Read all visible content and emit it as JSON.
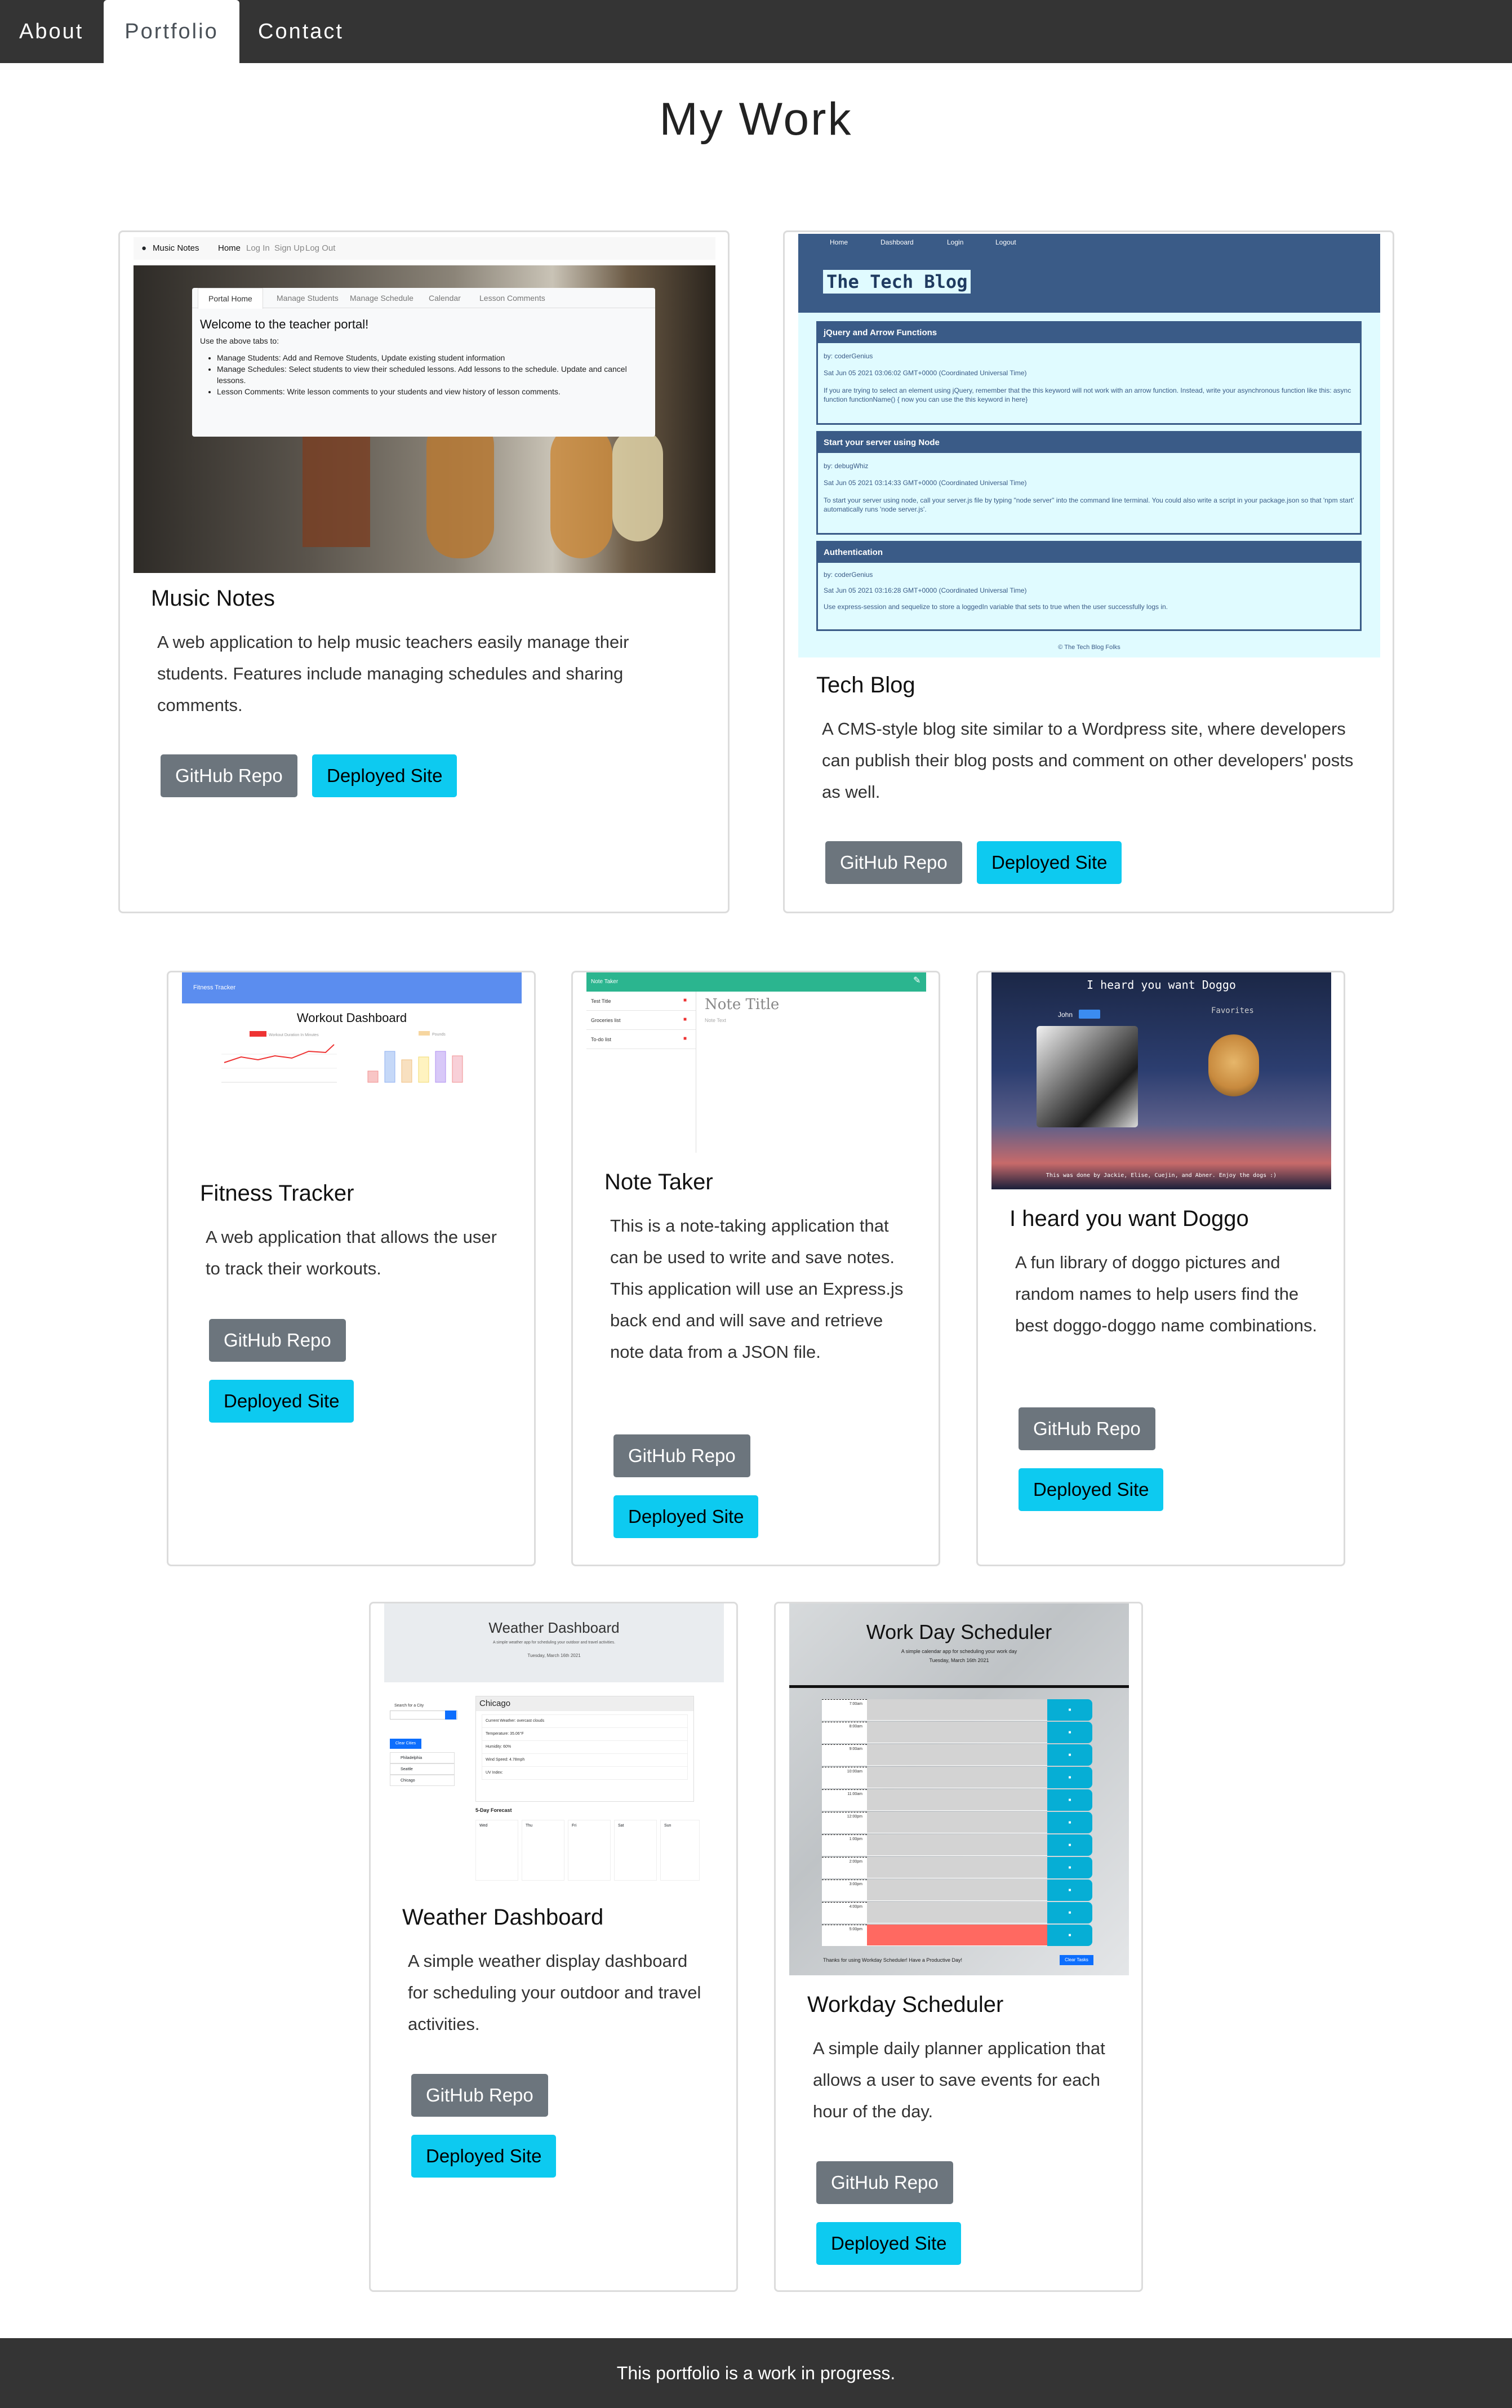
{
  "nav": {
    "items": [
      {
        "label": "About"
      },
      {
        "label": "Portfolio"
      },
      {
        "label": "Contact"
      }
    ]
  },
  "page": {
    "title": "My Work"
  },
  "projects": [
    {
      "title": "Music Notes",
      "description": "A web application to help music teachers easily manage their students. Features include managing schedules and sharing comments.",
      "repo_label": "GitHub Repo",
      "site_label": "Deployed Site",
      "preview": {
        "brand": "Music Notes",
        "nav": [
          "Home",
          "Log In",
          "Sign Up",
          "Log Out"
        ],
        "tabs": [
          "Portal Home",
          "Manage Students",
          "Manage Schedule",
          "Calendar",
          "Lesson Comments"
        ],
        "heading": "Welcome to the teacher portal!",
        "intro": "Use the above tabs to:",
        "bullets": [
          "Manage Students: Add and Remove Students, Update existing student information",
          "Manage Schedules: Select students to view their scheduled lessons. Add lessons to the schedule. Update and cancel lessons.",
          "Lesson Comments: Write lesson comments to your students and view history of lesson comments."
        ]
      }
    },
    {
      "title": "Tech Blog",
      "description": "A CMS-style blog site similar to a Wordpress site, where developers can publish their blog posts and comment on other developers' posts as well.",
      "repo_label": "GitHub Repo",
      "site_label": "Deployed Site",
      "preview": {
        "nav": [
          "Home",
          "Dashboard",
          "Login",
          "Logout"
        ],
        "brand": "The Tech Blog",
        "posts": [
          {
            "title": "jQuery and Arrow Functions",
            "author": "by: coderGenius",
            "date": "Sat Jun 05 2021 03:06:02 GMT+0000 (Coordinated Universal Time)",
            "body": "If you are trying to select an element using jQuery, remember that the this keyword will not work with an arrow function. Instead, write your asynchronous function like this: async function functionName() { now you can use the this keyword in here}"
          },
          {
            "title": "Start your server using Node",
            "author": "by: debugWhiz",
            "date": "Sat Jun 05 2021 03:14:33 GMT+0000 (Coordinated Universal Time)",
            "body": "To start your server using node, call your server.js file by typing \"node server\" into the command line terminal. You could also write a script in your package.json so that 'npm start' automatically runs 'node server.js'."
          },
          {
            "title": "Authentication",
            "author": "by: coderGenius",
            "date": "Sat Jun 05 2021 03:16:28 GMT+0000 (Coordinated Universal Time)",
            "body": "Use express-session and sequelize to store a loggedIn variable that sets to true when the user successfully logs in."
          }
        ],
        "footer": "© The Tech Blog Folks"
      }
    },
    {
      "title": "Fitness Tracker",
      "description": "A web application that allows the user to track their workouts.",
      "repo_label": "GitHub Repo",
      "site_label": "Deployed Site",
      "preview": {
        "brand": "Fitness Tracker",
        "heading": "Workout Dashboard",
        "legend1": "Workout Duration In Minutes",
        "legend2": "Pounds"
      }
    },
    {
      "title": "Note Taker",
      "description": "This is a note-taking application that can be used to write and save notes. This application will use an Express.js back end and will save and retrieve note data from a JSON file.",
      "repo_label": "GitHub Repo",
      "site_label": "Deployed Site",
      "preview": {
        "brand": "Note Taker",
        "notes": [
          "Test Title",
          "Groceries list",
          "To-do list"
        ],
        "note_title": "Note Title",
        "note_text": "Note Text"
      }
    },
    {
      "title": "I heard you want Doggo",
      "description": "A fun library of doggo pictures and random names to help users find the best doggo-doggo name combinations.",
      "repo_label": "GitHub Repo",
      "site_label": "Deployed Site",
      "preview": {
        "heading": "I heard you want Doggo",
        "name": "John",
        "favorites": "Favorites",
        "credit": "This was done by Jackie, Elise, Cuejin, and Abner. Enjoy the dogs :)"
      }
    },
    {
      "title": "Weather Dashboard",
      "description": "A simple weather display dashboard for scheduling your outdoor and travel activities.",
      "repo_label": "GitHub Repo",
      "site_label": "Deployed Site",
      "preview": {
        "heading": "Weather Dashboard",
        "sub": "A simple weather app for scheduling your outdoor and travel activities.",
        "date": "Tuesday, March 16th 2021",
        "search": "Search for a City",
        "clear": "Clear Cities",
        "cities": [
          "Philadelphia",
          "Seattle",
          "Chicago"
        ],
        "city": "Chicago",
        "current": [
          "Current Weather: overcast clouds",
          "Temperature: 35.06°F",
          "Humidity: 60%",
          "Wind Speed: 4.78mph",
          "UV Index:"
        ],
        "forecast_label": "5-Day Forecast",
        "days": [
          "Wed",
          "Thu",
          "Fri",
          "Sat",
          "Sun"
        ]
      }
    },
    {
      "title": "Workday Scheduler",
      "description": "A simple daily planner application that allows a user to save events for each hour of the day.",
      "repo_label": "GitHub Repo",
      "site_label": "Deployed Site",
      "preview": {
        "heading": "Work Day Scheduler",
        "sub": "A simple calendar app for scheduling your work day",
        "date": "Tuesday, March 16th 2021",
        "hours": [
          "7:00am",
          "8:00am",
          "9:00am",
          "10:00am",
          "11:00am",
          "12:00pm",
          "1:00pm",
          "2:00pm",
          "3:00pm",
          "4:00pm",
          "5:00pm"
        ],
        "bottom": "Thanks for using Workday Scheduler! Have a Productive Day!",
        "clear": "Clear Tasks"
      }
    }
  ],
  "footer": {
    "text": "This portfolio is a work in progress."
  },
  "colors": {
    "nav": "#343434",
    "btn_gray": "#6c757d",
    "btn_cyan": "#0dcaf0",
    "tech_blog_header": "#3a5b87",
    "tech_blog_bg": "#e0fbff"
  }
}
